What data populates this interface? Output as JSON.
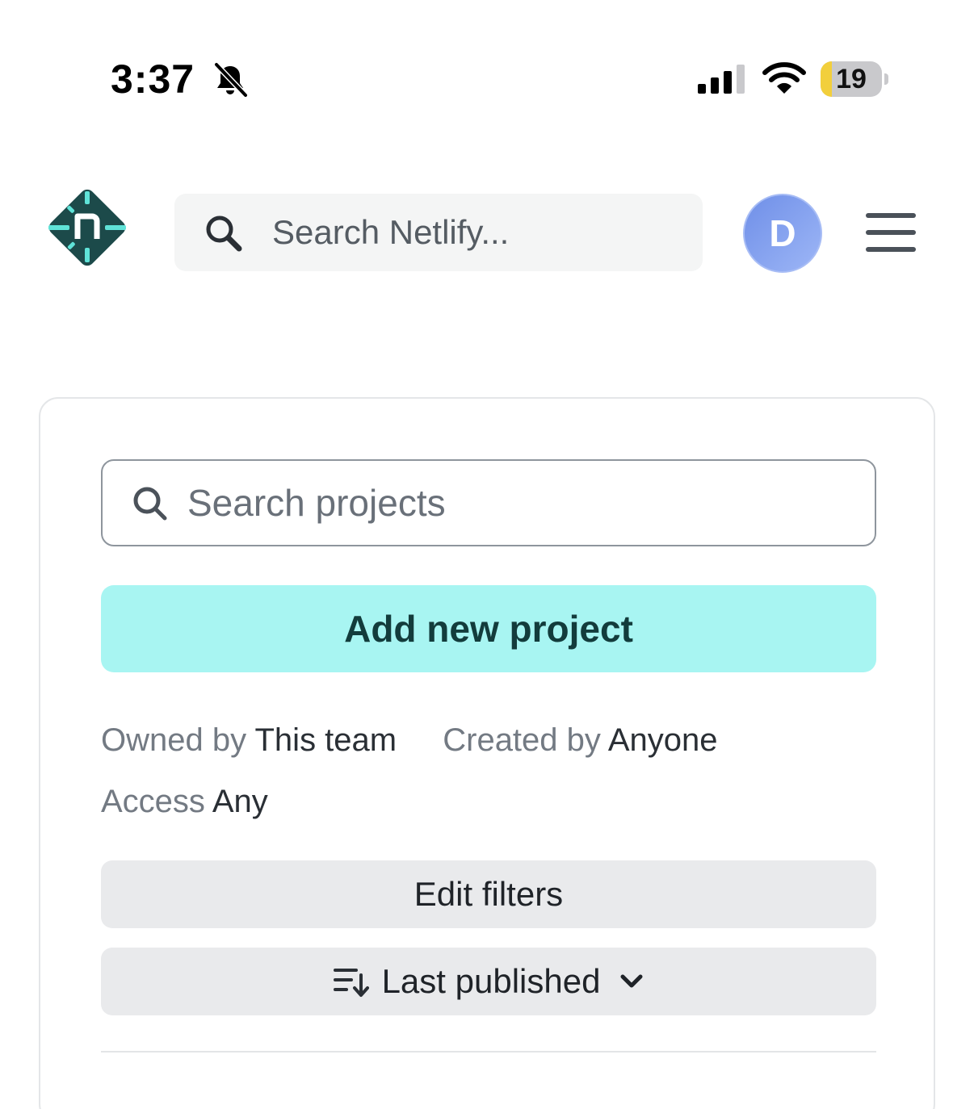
{
  "status_bar": {
    "time": "3:37",
    "battery": "19",
    "battery_level_percent": 19,
    "icons": [
      "bell-slash-icon",
      "cellular-signal-icon",
      "wifi-icon",
      "battery-icon"
    ]
  },
  "header": {
    "logo": "netlify-logo",
    "search_placeholder": "Search Netlify...",
    "avatar_initial": "D",
    "menu_icon": "hamburger-menu-icon"
  },
  "projects": {
    "search_placeholder": "Search projects",
    "add_button_label": "Add new project",
    "filters": [
      {
        "label": "Owned by",
        "value": "This team"
      },
      {
        "label": "Created by",
        "value": "Anyone"
      },
      {
        "label": "Access",
        "value": "Any"
      }
    ],
    "edit_filters_label": "Edit filters",
    "sort_label": "Last published"
  },
  "colors": {
    "accent_button": "#a8f5f2",
    "accent_button_text": "#133c3c",
    "logo_bg": "#1c4a4a",
    "logo_accent": "#5fe3d8",
    "avatar": "#7f9ef0",
    "gray_button": "#e9eaec"
  }
}
